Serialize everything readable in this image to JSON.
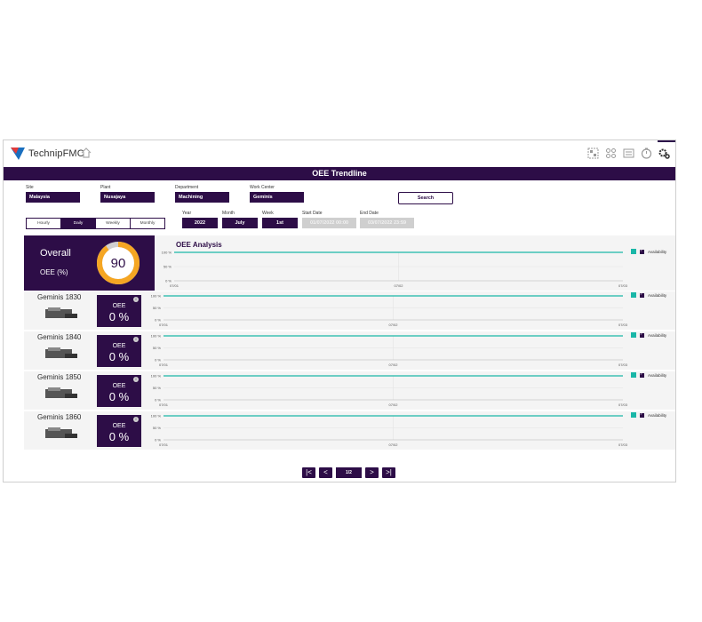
{
  "brand": {
    "name": "TechnipFMC",
    "color": "#2d0d47",
    "accent": "#1ab7a8"
  },
  "toolbar": {
    "icons": [
      "dashboard-icon",
      "grid-icon",
      "list-icon",
      "timer-icon",
      "settings-icon"
    ]
  },
  "page": {
    "title": "OEE Trendline"
  },
  "filters": {
    "site": {
      "label": "Site",
      "value": "Malaysia"
    },
    "plant": {
      "label": "Plant",
      "value": "Nusajaya"
    },
    "department": {
      "label": "Department",
      "value": "Machining"
    },
    "work_center": {
      "label": "Work Center",
      "value": "Geminis"
    },
    "year": {
      "label": "Year",
      "value": "2022"
    },
    "month": {
      "label": "Month",
      "value": "July"
    },
    "week": {
      "label": "Week",
      "value": "1st"
    },
    "start_date": {
      "label": "Start Date",
      "value": "01/07/2022 00:00"
    },
    "end_date": {
      "label": "End Date",
      "value": "03/07/2022 23:59"
    },
    "search_label": "Search"
  },
  "period_tabs": [
    {
      "label": "Hourly",
      "active": false
    },
    {
      "label": "Daily",
      "active": true
    },
    {
      "label": "Weekly",
      "active": false
    },
    {
      "label": "Monthly",
      "active": false
    }
  ],
  "overall": {
    "title": "Overall",
    "subtitle": "OEE (%)",
    "value": "90",
    "gauge_fraction": 0.9
  },
  "analysis": {
    "title": "OEE Analysis",
    "legend": "Availability"
  },
  "chart_data": [
    {
      "type": "line",
      "title": "OEE Analysis",
      "y_ticks": [
        "100 %",
        "50 %",
        "0 %"
      ],
      "x_ticks": [
        "07/01",
        "07/02",
        "07/03"
      ],
      "ylim": [
        0,
        100
      ],
      "series": [
        {
          "name": "Availability",
          "x": [
            "07/01",
            "07/03"
          ],
          "values": [
            100,
            100
          ]
        }
      ]
    },
    {
      "type": "line",
      "y_ticks": [
        "100 %",
        "50 %",
        "0 %"
      ],
      "x_ticks": [
        "07/01",
        "07/02",
        "07/03"
      ],
      "ylim": [
        0,
        100
      ],
      "series": [
        {
          "name": "Availability",
          "x": [
            "07/01",
            "07/03"
          ],
          "values": [
            100,
            100
          ]
        }
      ]
    },
    {
      "type": "line",
      "y_ticks": [
        "100 %",
        "50 %",
        "0 %"
      ],
      "x_ticks": [
        "07/01",
        "07/02",
        "07/03"
      ],
      "ylim": [
        0,
        100
      ],
      "series": [
        {
          "name": "Availability",
          "x": [
            "07/01",
            "07/03"
          ],
          "values": [
            100,
            100
          ]
        }
      ]
    },
    {
      "type": "line",
      "y_ticks": [
        "100 %",
        "50 %",
        "0 %"
      ],
      "x_ticks": [
        "07/01",
        "07/02",
        "07/03"
      ],
      "ylim": [
        0,
        100
      ],
      "series": [
        {
          "name": "Availability",
          "x": [
            "07/01",
            "07/03"
          ],
          "values": [
            100,
            100
          ]
        }
      ]
    },
    {
      "type": "line",
      "y_ticks": [
        "100 %",
        "50 %",
        "0 %"
      ],
      "x_ticks": [
        "07/01",
        "07/02",
        "07/03"
      ],
      "ylim": [
        0,
        100
      ],
      "series": [
        {
          "name": "Availability",
          "x": [
            "07/01",
            "07/03"
          ],
          "values": [
            100,
            100
          ]
        }
      ]
    }
  ],
  "machines": [
    {
      "name": "Geminis 1830",
      "oee_label": "OEE",
      "oee_value": "0 %"
    },
    {
      "name": "Geminis 1840",
      "oee_label": "OEE",
      "oee_value": "0 %"
    },
    {
      "name": "Geminis 1850",
      "oee_label": "OEE",
      "oee_value": "0 %"
    },
    {
      "name": "Geminis 1860",
      "oee_label": "OEE",
      "oee_value": "0 %"
    }
  ],
  "pager": {
    "first": "|<",
    "prev": "<",
    "page": "1/2",
    "next": ">",
    "last": ">|"
  }
}
